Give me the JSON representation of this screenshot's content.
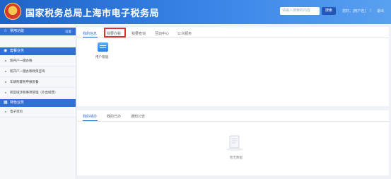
{
  "header": {
    "title": "国家税务总局上海市电子税务局",
    "search_placeholder": "请输入搜索的内容",
    "search_button": "搜索",
    "user_text": "您好，[用户名]",
    "separator": "|",
    "logout": "退出"
  },
  "sidebar": {
    "my_functions": {
      "label": "常用功能",
      "right": "设置"
    },
    "section1": {
      "label": "套餐业务"
    },
    "section1_items": [
      {
        "label": "新开户一键办税"
      },
      {
        "label": "新开户一键办税政策咨询"
      },
      {
        "label": "车辆购置税申报套餐"
      },
      {
        "label": "跨区域涉税事项管理（外出经营）"
      }
    ],
    "section2": {
      "label": "特色业务"
    },
    "section2_items": [
      {
        "label": "电子资料"
      }
    ]
  },
  "main": {
    "tabs": [
      {
        "label": "我的信息"
      },
      {
        "label": "我要办税"
      },
      {
        "label": "我要查询"
      },
      {
        "label": "互动中心"
      },
      {
        "label": "公众服务"
      }
    ],
    "app_tile": {
      "label": "用户管理"
    },
    "bottom_tabs": [
      {
        "label": "我的待办"
      },
      {
        "label": "我的已办"
      },
      {
        "label": "通知公告"
      }
    ],
    "empty_text": "暂无数据"
  },
  "colors": {
    "accent": "#2f6fd6",
    "header_start": "#1f63c7",
    "highlight_border": "#e03030"
  },
  "icons": {
    "emblem": "tax-bureau-emblem-icon",
    "star": "star-icon",
    "package": "package-icon",
    "special": "grid-icon",
    "app": "user-management-icon",
    "empty": "empty-document-icon"
  }
}
